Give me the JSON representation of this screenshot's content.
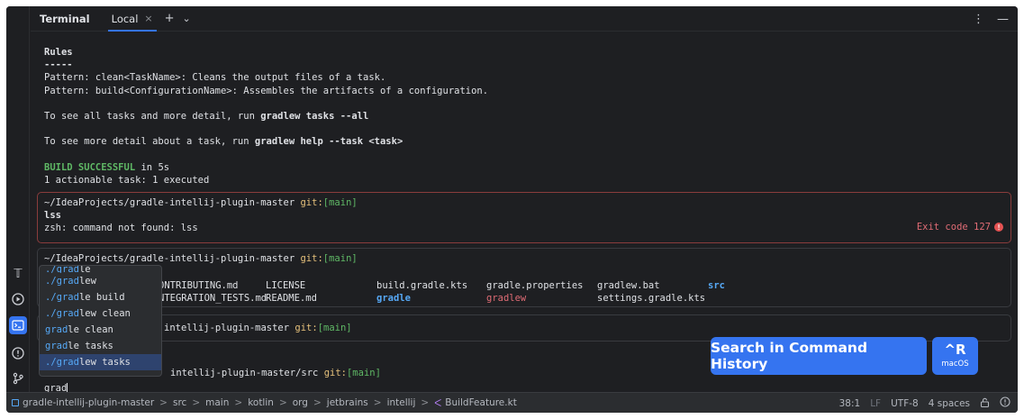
{
  "header": {
    "title": "Terminal",
    "tab_label": "Local",
    "close_icon": "×",
    "add_icon": "+",
    "dropdown_icon": "⌄",
    "more_icon": "⋮",
    "minimize_icon": "—"
  },
  "output": {
    "rules_heading": "Rules",
    "rules_rule": "-----",
    "rule_clean": "Pattern: clean<TaskName>: Cleans the output files of a task.",
    "rule_build": "Pattern: build<ConfigurationName>: Assembles the artifacts of a configuration.",
    "all_prefix": "To see all tasks and more detail, run ",
    "all_cmd": "gradlew tasks --all",
    "help_prefix": "To see more detail about a task, run ",
    "help_cmd": "gradlew help --task <task>",
    "build_status": "BUILD SUCCESSFUL",
    "build_time": " in 5s",
    "actionable": "1 actionable task: 1 executed"
  },
  "blocks": {
    "error": {
      "path": "~/IdeaProjects/gradle-intellij-plugin-master ",
      "git_key": "git:",
      "git_branch": "[main]",
      "command": "lss",
      "message": "zsh: command not found: lss",
      "exit_label": "Exit code 127",
      "exit_icon": "!"
    },
    "ls": {
      "path": "~/IdeaProjects/gradle-intellij-plugin-master ",
      "git_key": "git:",
      "git_branch": "[main]",
      "entries": {
        "contributing": "ONTRIBUTING.md",
        "integration": "NTEGRATION_TESTS.md",
        "license": "LICENSE",
        "readme": "README.md",
        "build_kts": "build.gradle.kts",
        "gradle_dir": "gradle",
        "gradle_props": "gradle.properties",
        "gradlew": "gradlew",
        "gradlew_bat": "gradlew.bat",
        "settings_kts": "settings.gradle.kts",
        "src": "src"
      }
    },
    "third": {
      "path_tail": "intellij-plugin-master ",
      "git_key": "git:",
      "git_branch": "[main]"
    },
    "current": {
      "path_tail": "intellij-plugin-master/src ",
      "git_key": "git:",
      "git_branch": "[main]",
      "input": "grad"
    }
  },
  "completion": {
    "items": [
      {
        "match": "./grad",
        "rest": "le"
      },
      {
        "match": "./grad",
        "rest": "lew"
      },
      {
        "match": "./grad",
        "rest": "le build"
      },
      {
        "match": "./grad",
        "rest": "lew clean"
      },
      {
        "match": "grad",
        "rest": "le clean"
      },
      {
        "match": "grad",
        "rest": "le tasks"
      },
      {
        "match": "./grad",
        "rest": "lew tasks"
      }
    ],
    "selected_index": 6
  },
  "history": {
    "label": "Search in Command History",
    "shortcut": "^R",
    "os": "macOS"
  },
  "statusbar": {
    "crumbs": [
      "gradle-intellij-plugin-master",
      "src",
      "main",
      "kotlin",
      "org",
      "jetbrains",
      "intellij",
      "BuildFeature.kt"
    ],
    "kotlin_icon": "ᐸ",
    "position": "38:1",
    "line_sep": "LF",
    "encoding": "UTF-8",
    "indent": "4 spaces",
    "lock_icon": "🔓",
    "notifications_icon": "ⓘ",
    "separator": ">"
  },
  "tools": {
    "bookmark_icon": "𝕋",
    "run_icon": "▷",
    "terminal_icon": ">_",
    "problems_icon": "!",
    "git_icon": "⑂"
  },
  "colors": {
    "accent": "#3574f0",
    "success": "#5fb865",
    "error": "#e06c75"
  }
}
